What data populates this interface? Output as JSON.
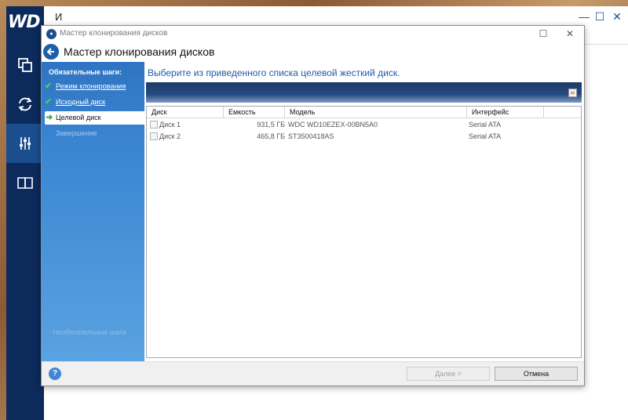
{
  "background_app": {
    "title": "И",
    "brand": "WD"
  },
  "dialog": {
    "title": "Мастер клонирования дисков",
    "header_title": "Мастер клонирования дисков",
    "instruction": "Выберите из приведенного списка целевой жесткий диск."
  },
  "steps": {
    "heading": "Обязательные шаги:",
    "items": [
      {
        "label": "Режим клонирования",
        "state": "done"
      },
      {
        "label": "Исходный диск",
        "state": "done"
      },
      {
        "label": "Целевой диск",
        "state": "current"
      },
      {
        "label": "Завершение",
        "state": "disabled"
      }
    ],
    "footer": "Необязательные шаги"
  },
  "disk_list": {
    "columns": [
      "Диск",
      "Емкость",
      "Модель",
      "Интерфейс"
    ],
    "rows": [
      {
        "disk": "Диск 1",
        "capacity": "931,5 ГБ",
        "model": "WDC WD10EZEX-00BN5A0",
        "interface": "Serial ATA"
      },
      {
        "disk": "Диск 2",
        "capacity": "465,8 ГБ",
        "model": "ST3500418AS",
        "interface": "Serial ATA"
      }
    ]
  },
  "footer": {
    "next_label": "Далее >",
    "cancel_label": "Отмена"
  },
  "colors": {
    "sidebar": "#0c2a5b",
    "steps_panel": "#3b86d3",
    "instruction_text": "#1f5aa6"
  }
}
